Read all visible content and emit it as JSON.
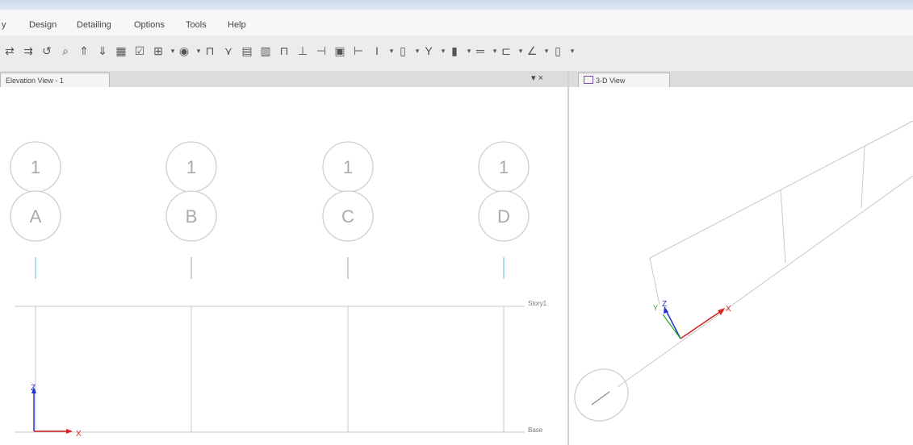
{
  "menu": {
    "items": [
      {
        "id": "view",
        "label": "y"
      },
      {
        "id": "design",
        "label": "Design"
      },
      {
        "id": "detailing",
        "label": "Detailing"
      },
      {
        "id": "options",
        "label": "Options"
      },
      {
        "id": "tools",
        "label": "Tools"
      },
      {
        "id": "help",
        "label": "Help"
      }
    ]
  },
  "toolbar": {
    "icons": [
      {
        "name": "align-points-icon",
        "glyph": "⇄"
      },
      {
        "name": "align-joints-icon",
        "glyph": "⇉"
      },
      {
        "name": "undo-rotate-icon",
        "glyph": "↺"
      },
      {
        "name": "rubber-band-zoom-icon",
        "glyph": "⌕"
      },
      {
        "name": "move-up-icon",
        "glyph": "⇑"
      },
      {
        "name": "move-down-icon",
        "glyph": "⇓"
      },
      {
        "name": "select-icon",
        "glyph": "▦"
      },
      {
        "name": "checkbox-select-icon",
        "glyph": "☑"
      },
      {
        "name": "display-options-icon",
        "glyph": "⊞"
      },
      {
        "name": "dropdown-arrow-icon",
        "glyph": "▾"
      },
      {
        "name": "object-shrink-icon",
        "glyph": "◉"
      },
      {
        "name": "dropdown-arrow-icon",
        "glyph": "▾"
      },
      {
        "name": "draw-frame-icon",
        "glyph": "⊓"
      },
      {
        "name": "draw-brace-icon",
        "glyph": "⋎"
      },
      {
        "name": "draw-floor-icon",
        "glyph": "▤"
      },
      {
        "name": "draw-wall-icon",
        "glyph": "▥"
      },
      {
        "name": "draw-opening-icon",
        "glyph": "⊓"
      },
      {
        "name": "draw-support-icon",
        "glyph": "⊥"
      },
      {
        "name": "draw-link-icon",
        "glyph": "⊣"
      },
      {
        "name": "draw-area-icon",
        "glyph": "▣"
      },
      {
        "name": "draw-tendon-icon",
        "glyph": "⊢"
      },
      {
        "name": "draw-beam-icon",
        "glyph": "I"
      },
      {
        "name": "dropdown-arrow-icon",
        "glyph": "▾"
      },
      {
        "name": "draw-column-icon",
        "glyph": "▯"
      },
      {
        "name": "dropdown-arrow-icon",
        "glyph": "▾"
      },
      {
        "name": "draw-column-section-icon",
        "glyph": "Y"
      },
      {
        "name": "dropdown-arrow-icon",
        "glyph": "▾"
      },
      {
        "name": "draw-wall-section-icon",
        "glyph": "▮"
      },
      {
        "name": "dropdown-arrow-icon",
        "glyph": "▾"
      },
      {
        "name": "draw-slab-icon",
        "glyph": "═"
      },
      {
        "name": "dropdown-arrow-icon",
        "glyph": "▾"
      },
      {
        "name": "draw-deck-icon",
        "glyph": "⊏"
      },
      {
        "name": "dropdown-arrow-icon",
        "glyph": "▾"
      },
      {
        "name": "draw-dimension-icon",
        "glyph": "∠"
      },
      {
        "name": "dropdown-arrow-icon",
        "glyph": "▾"
      },
      {
        "name": "draw-reference-icon",
        "glyph": "▯"
      },
      {
        "name": "dropdown-arrow-icon",
        "glyph": "▾"
      }
    ]
  },
  "left_panel": {
    "title": "Elevation View - 1",
    "controls": "▾ ×",
    "grid_top_label": "1",
    "grids": [
      {
        "story": "1",
        "name": "A"
      },
      {
        "story": "1",
        "name": "B"
      },
      {
        "story": "1",
        "name": "C"
      },
      {
        "story": "1",
        "name": "D"
      }
    ],
    "stories": [
      {
        "name": "Story1"
      },
      {
        "name": "Base"
      }
    ],
    "axis": {
      "z": "Z",
      "x": "X"
    }
  },
  "right_panel": {
    "title": "3-D View",
    "axis": {
      "x": "X",
      "y": "Y",
      "z": "Z"
    }
  },
  "colors": {
    "grid_bubble_stroke": "#cfcfcf",
    "grid_tick_cyan": "#8fd4e6",
    "line_gray": "#c8c8c8",
    "axis_z": "#2233cc",
    "axis_x": "#d22222",
    "axis_y": "#22aa22"
  }
}
